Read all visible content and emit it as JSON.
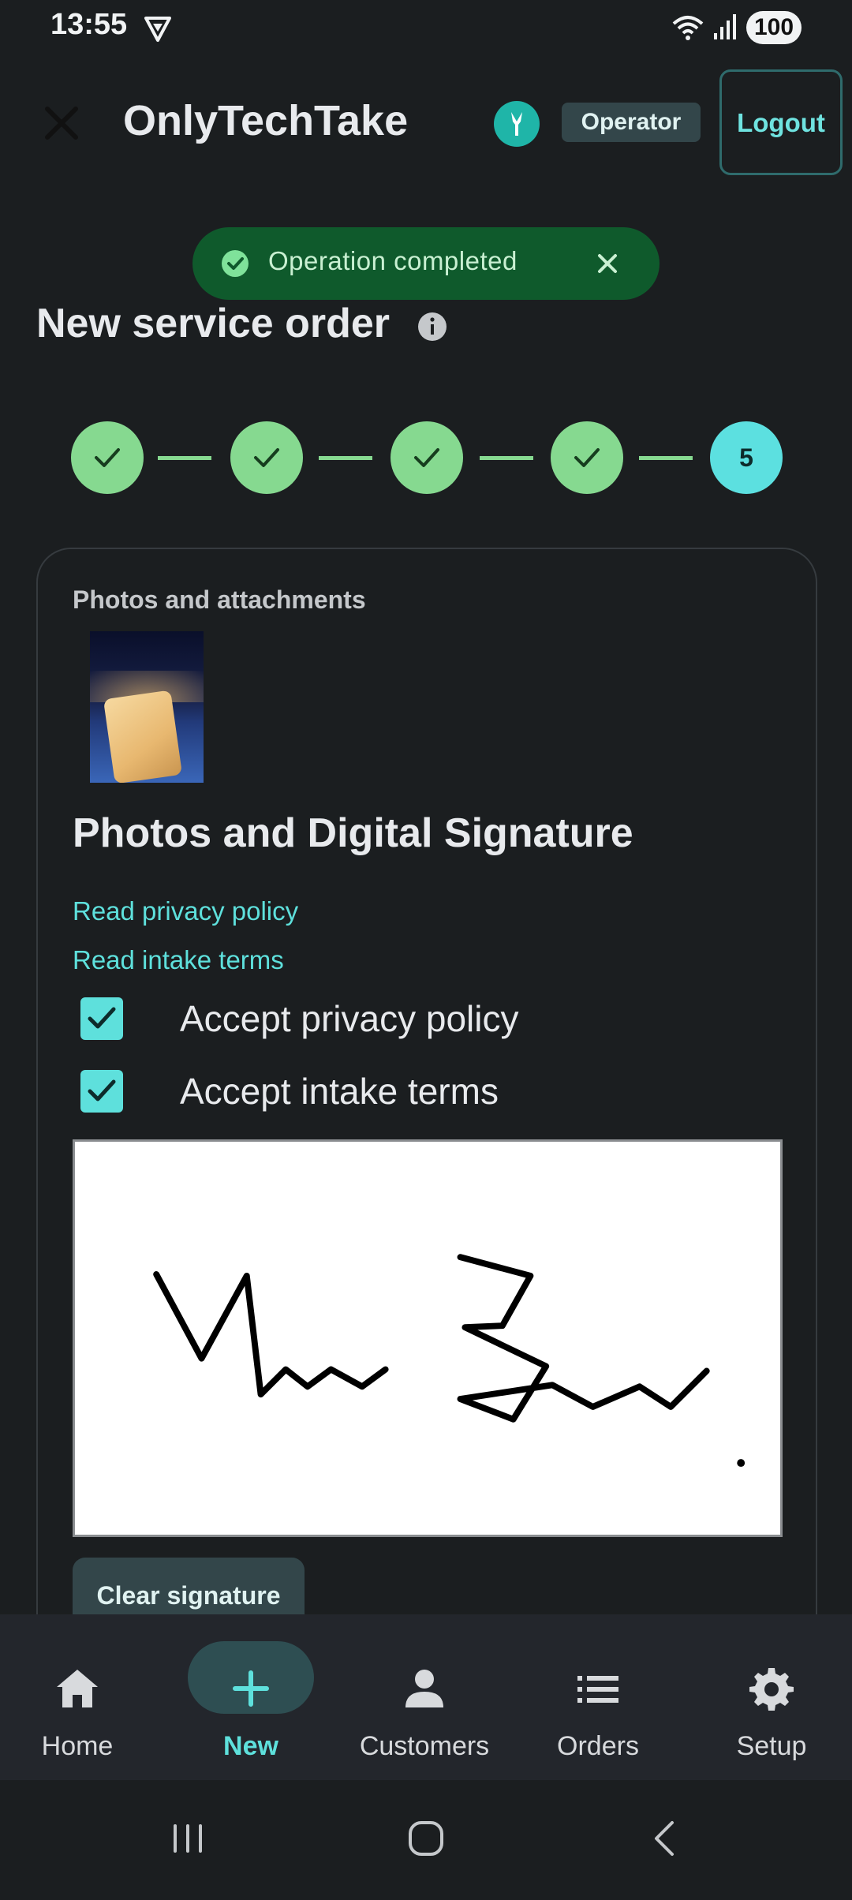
{
  "status_bar": {
    "time": "13:55",
    "battery": "100"
  },
  "app_bar": {
    "title": "OnlyTechTake",
    "role": "Operator",
    "logout_label": "Logout"
  },
  "toast": {
    "message": "Operation completed"
  },
  "page": {
    "title": "New service order"
  },
  "stepper": {
    "current_step_label": "5",
    "completed_steps": 4,
    "total_steps": 5
  },
  "card": {
    "attachments_label": "Photos and attachments",
    "section_title": "Photos and Digital Signature",
    "privacy_link": "Read privacy policy",
    "terms_link": "Read intake terms",
    "accept_privacy": "Accept privacy policy",
    "accept_terms": "Accept intake terms",
    "clear_signature": "Clear signature"
  },
  "bottom_nav": {
    "items": [
      {
        "label": "Home",
        "icon": "home-icon"
      },
      {
        "label": "New",
        "icon": "plus-icon"
      },
      {
        "label": "Customers",
        "icon": "person-icon"
      },
      {
        "label": "Orders",
        "icon": "list-icon"
      },
      {
        "label": "Setup",
        "icon": "gear-icon"
      }
    ],
    "active_index": 1
  },
  "colors": {
    "accent": "#5ee0dc",
    "success": "#86d990",
    "toast_bg": "#0f5a2c",
    "background": "#1b1e20"
  }
}
